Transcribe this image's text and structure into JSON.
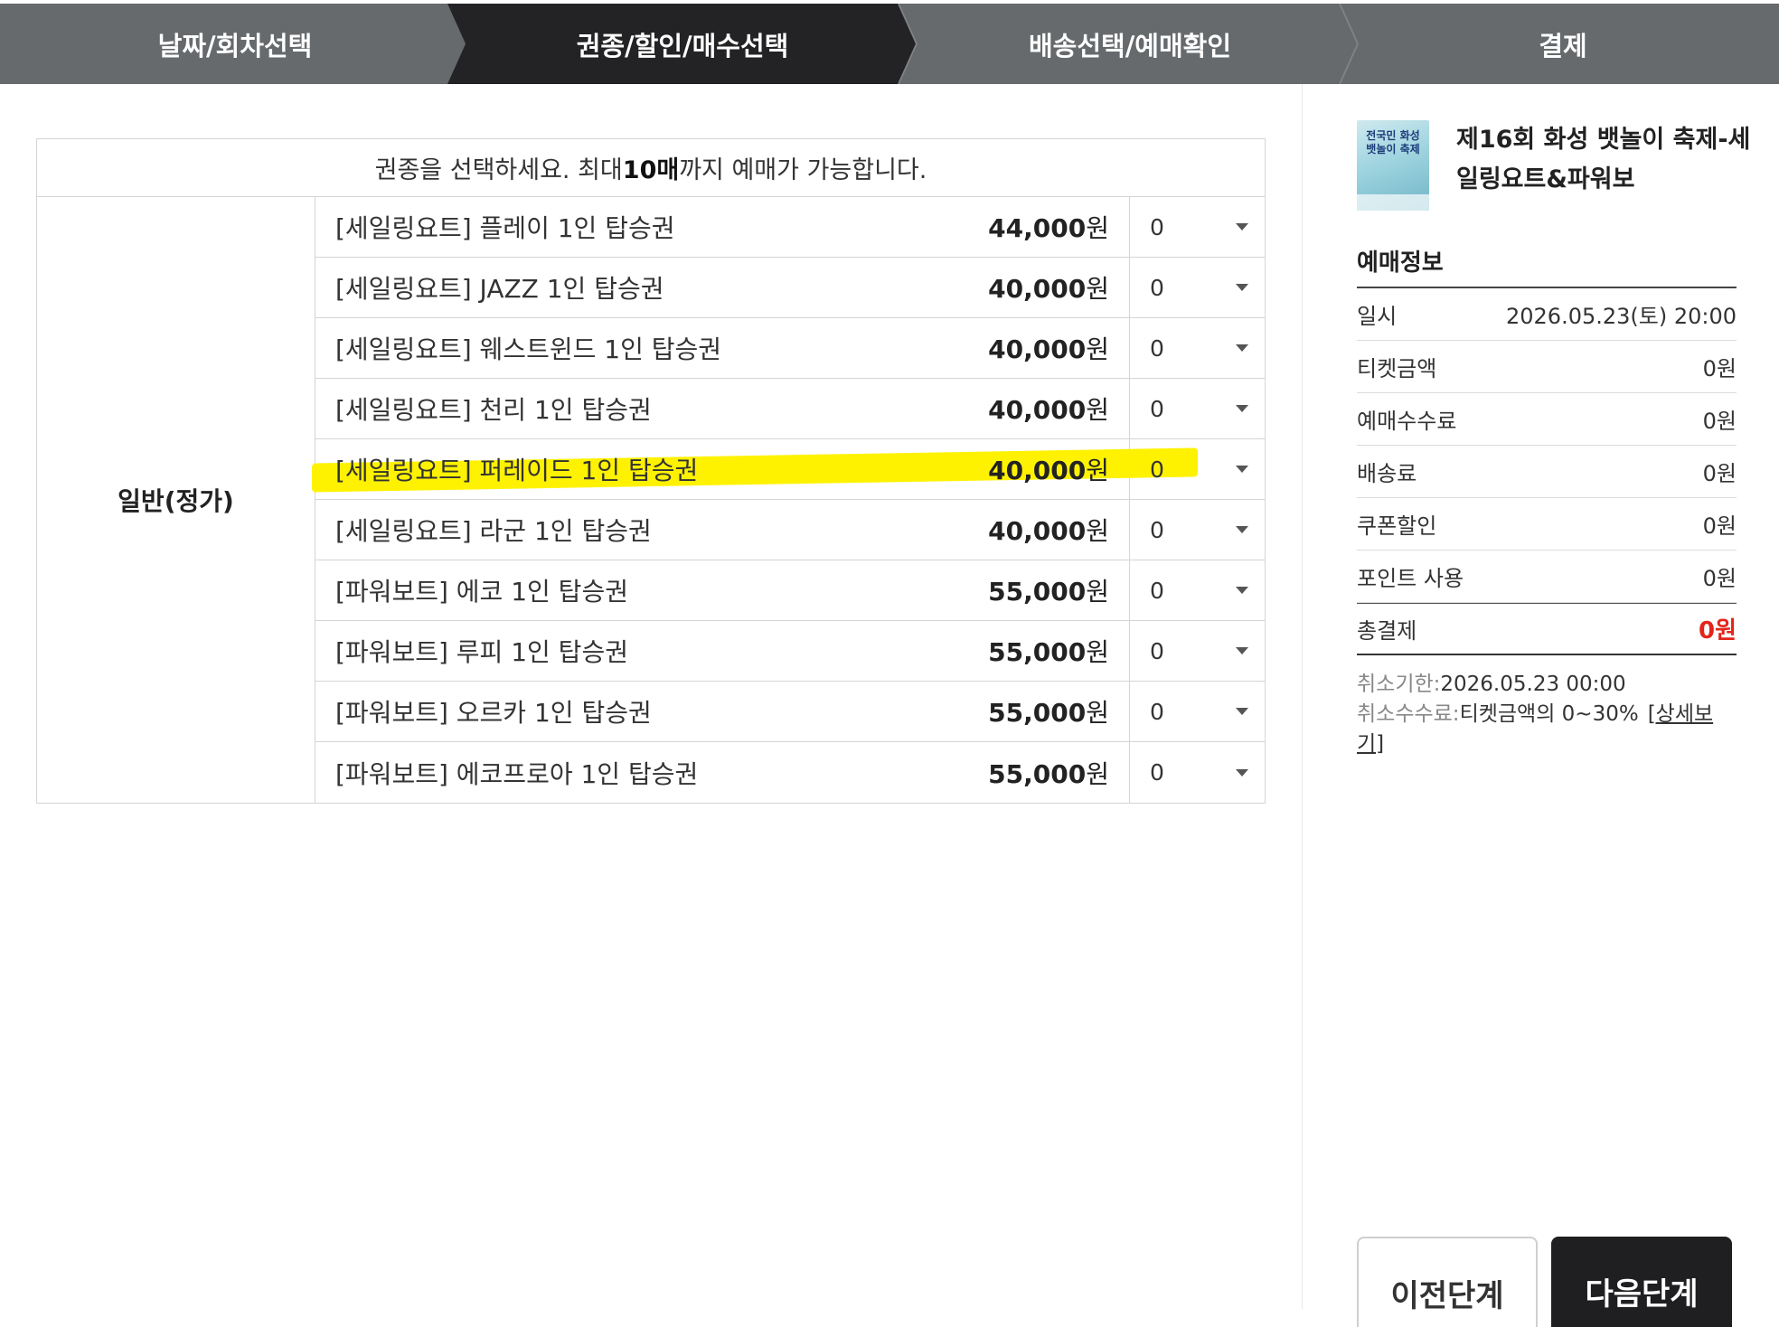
{
  "steps": [
    {
      "label": "날짜/회차선택",
      "active": false
    },
    {
      "label": "권종/할인/매수선택",
      "active": true
    },
    {
      "label": "배송선택/예매확인",
      "active": false
    },
    {
      "label": "결제",
      "active": false
    }
  ],
  "notice": {
    "prefix": "권종을 선택하세요. 최대",
    "highlight": "10매",
    "suffix": "까지 예매가 가능합니다."
  },
  "category": "일반(정가)",
  "tickets": [
    {
      "name": "[세일링요트] 플레이 1인 탑승권",
      "price": "44,000",
      "unit": "원",
      "qty": "0"
    },
    {
      "name": "[세일링요트] JAZZ 1인 탑승권",
      "price": "40,000",
      "unit": "원",
      "qty": "0"
    },
    {
      "name": "[세일링요트] 웨스트윈드 1인 탑승권",
      "price": "40,000",
      "unit": "원",
      "qty": "0"
    },
    {
      "name": "[세일링요트] 천리 1인 탑승권",
      "price": "40,000",
      "unit": "원",
      "qty": "0"
    },
    {
      "name": "[세일링요트] 퍼레이드 1인 탑승권",
      "price": "40,000",
      "unit": "원",
      "qty": "0",
      "highlighted": true
    },
    {
      "name": "[세일링요트] 라군 1인 탑승권",
      "price": "40,000",
      "unit": "원",
      "qty": "0"
    },
    {
      "name": "[파워보트] 에코 1인 탑승권",
      "price": "55,000",
      "unit": "원",
      "qty": "0"
    },
    {
      "name": "[파워보트] 루피 1인 탑승권",
      "price": "55,000",
      "unit": "원",
      "qty": "0"
    },
    {
      "name": "[파워보트] 오르카 1인 탑승권",
      "price": "55,000",
      "unit": "원",
      "qty": "0"
    },
    {
      "name": "[파워보트] 에코프로아 1인 탑승권",
      "price": "55,000",
      "unit": "원",
      "qty": "0"
    }
  ],
  "side": {
    "poster_text": "전국민 화성 뱃놀이 축제",
    "title": "제16회 화성 뱃놀이 축제-세일링요트&파워보",
    "info_head": "예매정보",
    "rows": [
      {
        "label": "일시",
        "value": "2026.05.23(토) 20:00"
      },
      {
        "label": "티켓금액",
        "value": "0원"
      },
      {
        "label": "예매수수료",
        "value": "0원"
      },
      {
        "label": "배송료",
        "value": "0원"
      },
      {
        "label": "쿠폰할인",
        "value": "0원"
      },
      {
        "label": "포인트 사용",
        "value": "0원"
      }
    ],
    "total": {
      "label": "총결제",
      "value": "0원"
    },
    "cancel_deadline_label": "취소기한:",
    "cancel_deadline": "2026.05.23 00:00",
    "cancel_fee_label": "취소수수료:",
    "cancel_fee": "티켓금액의 0~30%",
    "detail_link": "[상세보기]"
  },
  "buttons": {
    "prev": "이전단계",
    "next": "다음단계"
  },
  "colors": {
    "active_step": "#232325",
    "step_bar": "#666a6d",
    "total_red": "#e3241b",
    "highlight": "#fff200"
  }
}
